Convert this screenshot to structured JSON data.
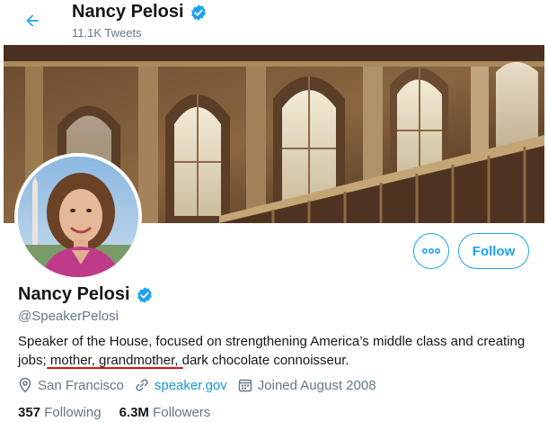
{
  "header": {
    "name": "Nancy Pelosi",
    "tweet_count": "11.1K Tweets"
  },
  "profile": {
    "display_name": "Nancy Pelosi",
    "handle": "@SpeakerPelosi",
    "bio": "Speaker of the House, focused on strengthening America’s middle class and creating jobs; mother, grandmother, dark chocolate connoisseur.",
    "location": "San Francisco",
    "website": "speaker.gov",
    "joined": "Joined August 2008",
    "following_count": "357",
    "following_label": "Following",
    "followers_count": "6.3M",
    "followers_label": "Followers"
  },
  "actions": {
    "more_label": "•••",
    "follow_label": "Follow"
  },
  "colors": {
    "accent": "#1da1f2",
    "link": "#1b95e0",
    "secondary_text": "#657786",
    "annotation_underline": "#d0161b"
  },
  "icons": [
    "back-arrow-icon",
    "verified-badge-icon",
    "more-options-icon",
    "location-pin-icon",
    "link-icon",
    "calendar-icon"
  ]
}
